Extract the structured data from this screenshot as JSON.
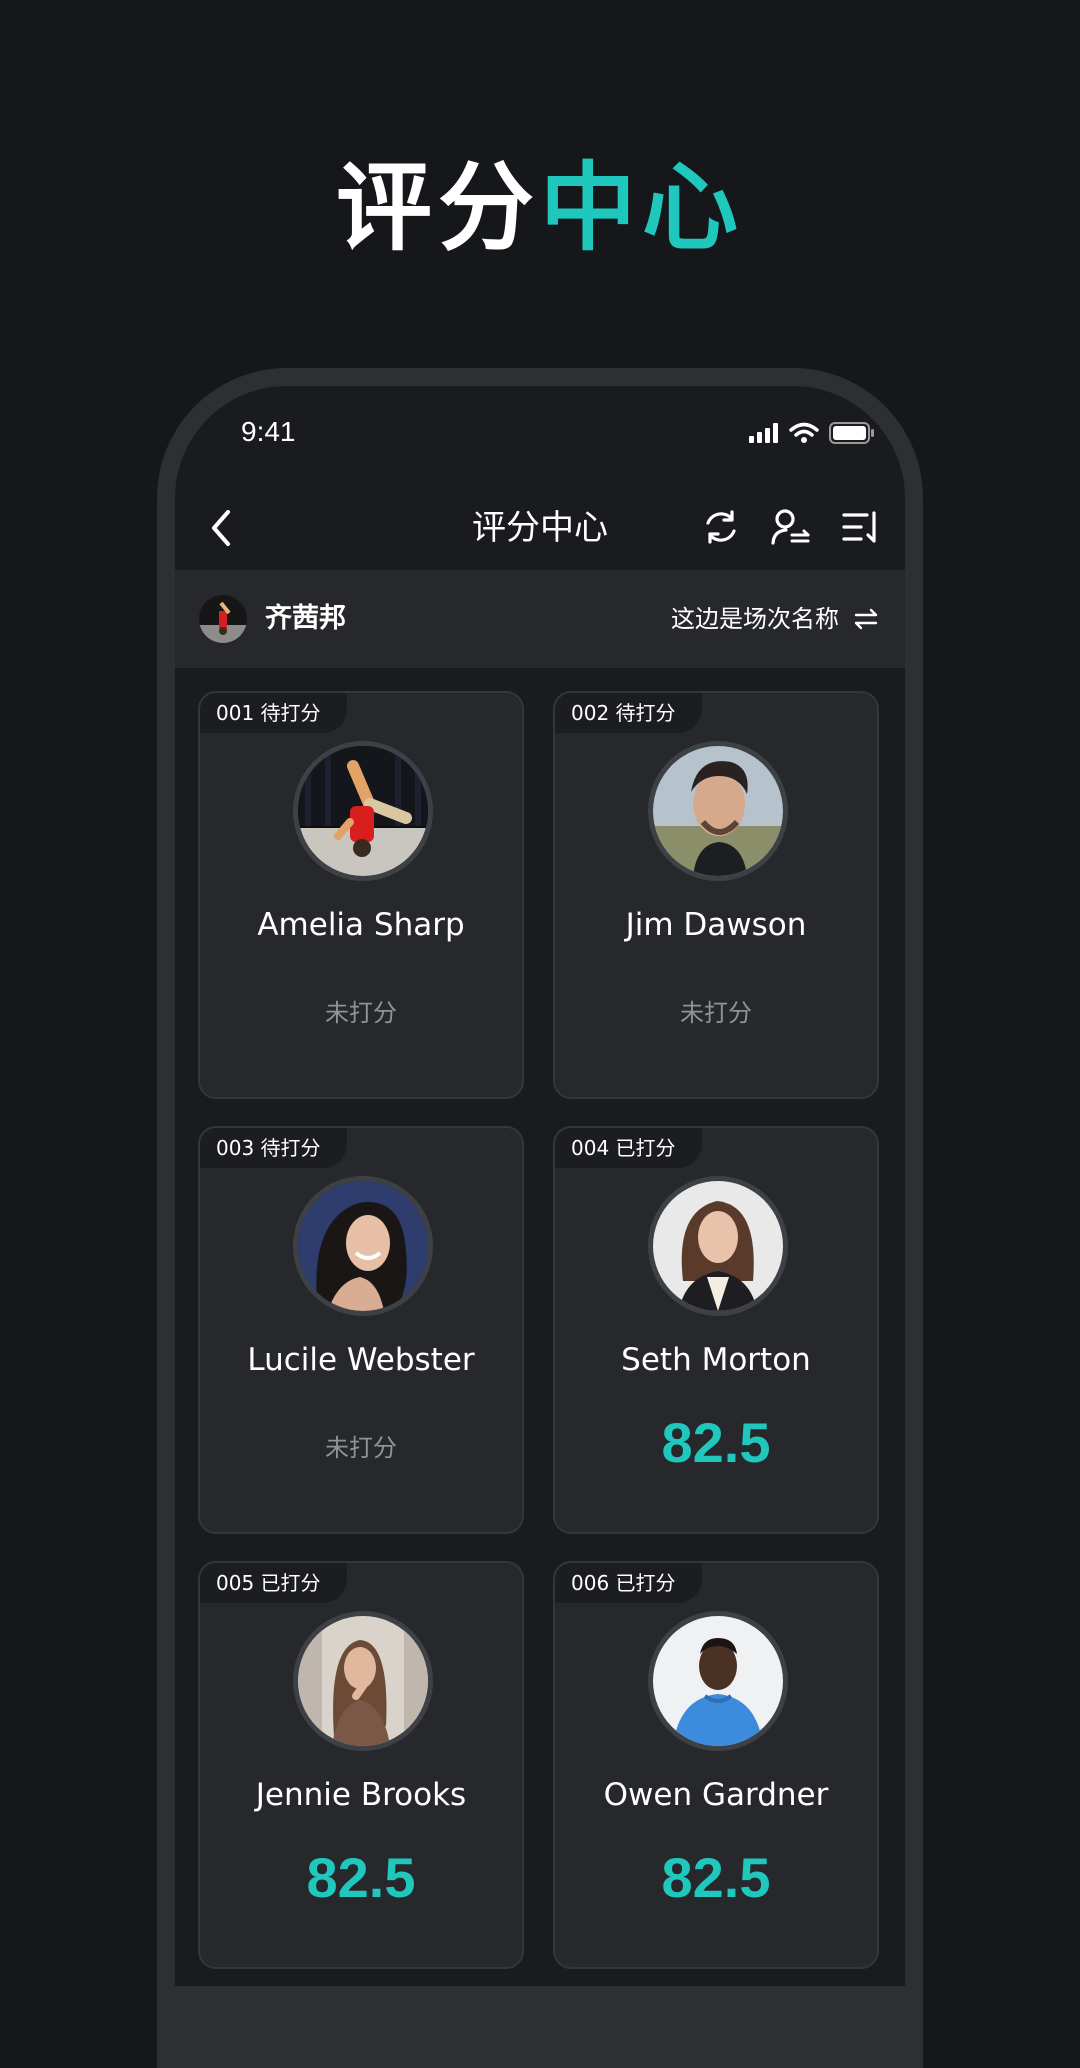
{
  "colors": {
    "background": "#16171b",
    "accent": "#1fc7bc",
    "card": "#26282c",
    "muted_text": "#8f9296"
  },
  "hero": {
    "title_part1": "评分",
    "title_part2": "中心"
  },
  "status_bar": {
    "time": "9:41",
    "icons": [
      "signal-icon",
      "wifi-icon",
      "battery-icon"
    ]
  },
  "nav": {
    "title": "评分中心",
    "back_icon": "chevron-left-icon",
    "actions": [
      "refresh-icon",
      "user-switch-icon",
      "sort-icon"
    ]
  },
  "judge": {
    "name": "齐茜邦",
    "session_name": "这边是场次名称",
    "switch_icon": "swap-arrows-icon"
  },
  "contestants": [
    {
      "tag": "001 待打分",
      "name": "Amelia Sharp",
      "status": "未打分",
      "score": null
    },
    {
      "tag": "002 待打分",
      "name": "Jim Dawson",
      "status": "未打分",
      "score": null
    },
    {
      "tag": "003 待打分",
      "name": "Lucile Webster",
      "status": "未打分",
      "score": null
    },
    {
      "tag": "004 已打分",
      "name": "Seth Morton",
      "status": null,
      "score": "82.5"
    },
    {
      "tag": "005 已打分",
      "name": "Jennie Brooks",
      "status": null,
      "score": "82.5"
    },
    {
      "tag": "006 已打分",
      "name": "Owen Gardner",
      "status": null,
      "score": "82.5"
    }
  ]
}
